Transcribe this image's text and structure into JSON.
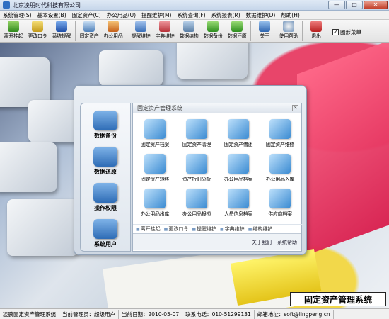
{
  "window": {
    "title": "北京凌朋时代科技有限公司",
    "min": "—",
    "max": "□",
    "close": "✕"
  },
  "menu": [
    "系统管理(S)",
    "基本设置(B)",
    "固定资产(C)",
    "办公用品(U)",
    "提醒维护(M)",
    "系统查询(F)",
    "系统报表(R)",
    "数据维护(D)",
    "帮助(H)"
  ],
  "toolbar": {
    "buttons": [
      {
        "label": "离开挂起",
        "icon": "user-icon"
      },
      {
        "label": "更改口令",
        "icon": "key-icon"
      },
      {
        "label": "系统提醒",
        "icon": "alert-icon"
      },
      {
        "label": "固定资产",
        "icon": "monitor-icon"
      },
      {
        "label": "办公用品",
        "icon": "office-icon"
      },
      {
        "label": "提醒维护",
        "icon": "reminder-icon"
      },
      {
        "label": "字典维护",
        "icon": "dictionary-icon"
      },
      {
        "label": "数据结构",
        "icon": "structure-icon"
      },
      {
        "label": "数据备份",
        "icon": "backup-icon"
      },
      {
        "label": "数据还原",
        "icon": "restore-icon"
      },
      {
        "label": "关于",
        "icon": "about-icon"
      },
      {
        "label": "使用帮助",
        "icon": "help-icon"
      },
      {
        "label": "退出",
        "icon": "exit-icon"
      }
    ],
    "check_label": "图形菜单"
  },
  "panel": {
    "side_items": [
      {
        "label": "数据备份"
      },
      {
        "label": "数据还原"
      },
      {
        "label": "操作权限"
      },
      {
        "label": "系统用户"
      }
    ],
    "header": "固定资产管理系统",
    "grid": [
      {
        "label": "固定资产档案"
      },
      {
        "label": "固定资产清理"
      },
      {
        "label": "固定资产借还"
      },
      {
        "label": "固定资产维修"
      },
      {
        "label": "固定资产转移"
      },
      {
        "label": "资产折旧分析"
      },
      {
        "label": "办公用品档案"
      },
      {
        "label": "办公用品入库"
      },
      {
        "label": "办公用品出库"
      },
      {
        "label": "办公用品报损"
      },
      {
        "label": "人员信息档案"
      },
      {
        "label": "供应商档案"
      }
    ],
    "bottom_links": [
      "离开挂起",
      "更改口令",
      "提醒维护",
      "字典维护",
      "结构维护"
    ],
    "footer": {
      "about": "关于我们",
      "help": "系统帮助"
    }
  },
  "brand_text": "固定资产管理系统",
  "status": {
    "app": "凌鹏固定资产管理系统",
    "admin": "当前管理员：超级用户",
    "date": "当前日期：2010-05-07",
    "phone": "联系电话：010-51299131",
    "email": "邮箱地址：soft@lingpeng.cn"
  },
  "colors": {
    "accent": "#2e6cb6",
    "brand_red": "#d81c4c"
  }
}
